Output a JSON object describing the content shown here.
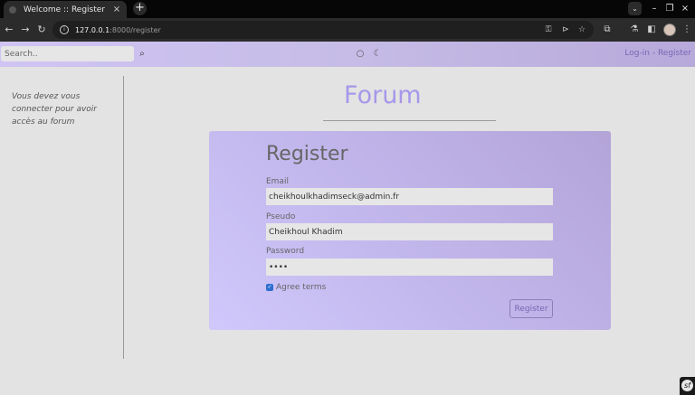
{
  "browser": {
    "tab": {
      "title": "Welcome :: Register",
      "close_icon": "×"
    },
    "new_tab_icon": "+",
    "tab_search_icon": "⌄",
    "window": {
      "minimize": "–",
      "maximize": "❐",
      "close": "×"
    },
    "nav": {
      "back": "←",
      "forward": "→",
      "reload": "↻"
    },
    "url": {
      "host": "127.0.0.1",
      "rest": ":8000/register"
    },
    "omnibox_icons": {
      "key": "⚿",
      "send": "⊳",
      "bookmark": "☆"
    },
    "toolbar_icons": {
      "extensions": "⧉",
      "labs": "⚗",
      "sidebar": "◧",
      "menu": "⋮"
    }
  },
  "header": {
    "search_placeholder": "Search..",
    "search_icon": "⌕",
    "light_icon": "○",
    "dark_icon": "☾",
    "login_label": "Log-in",
    "separator": " - ",
    "register_label": "Register"
  },
  "sidebar": {
    "message": "Vous devez vous connecter pour avoir accès au forum"
  },
  "logo": {
    "text": "Forum"
  },
  "form": {
    "title": "Register",
    "email_label": "Email",
    "email_value": "cheikhoulkhadimseck@admin.fr",
    "pseudo_label": "Pseudo",
    "pseudo_value": "Cheikhoul Khadim",
    "password_label": "Password",
    "password_value": "abcd",
    "terms_label": "Agree terms",
    "terms_checked": true,
    "submit_label": "Register"
  },
  "colors": {
    "accent": "#7866b5",
    "logo": "#a797ea"
  }
}
